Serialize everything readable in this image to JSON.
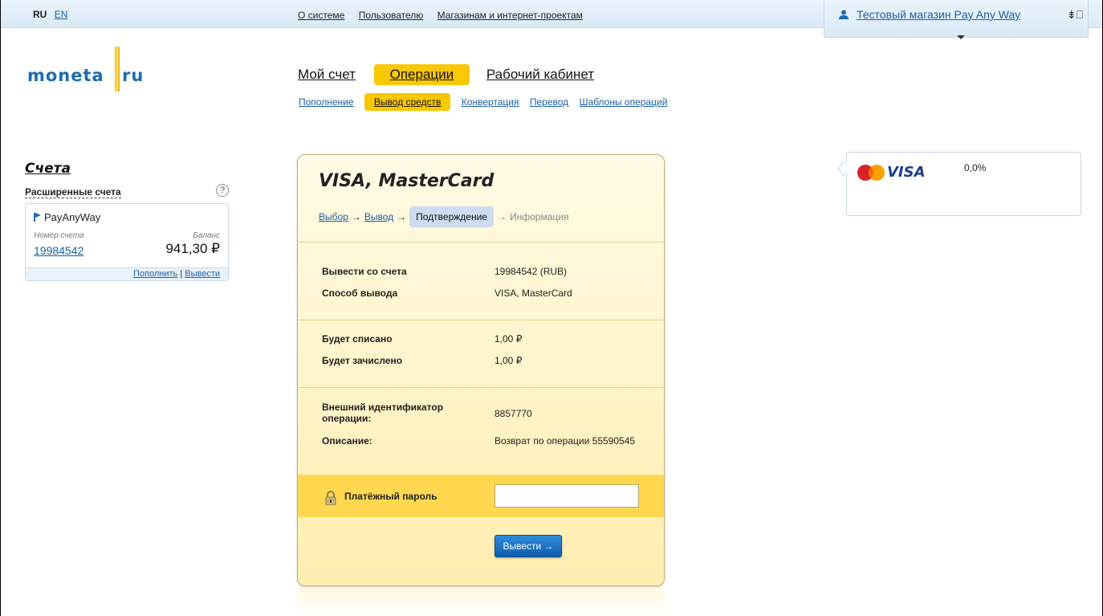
{
  "lang": {
    "ru": "RU",
    "en": "EN"
  },
  "topnav": [
    "О системе",
    "Пользователю",
    "Магазинам и интернет-проектам"
  ],
  "user": {
    "name": "Тестовый магазин Pay Any Way"
  },
  "logo": {
    "left": "moneta",
    "right": "ru"
  },
  "mainnav": {
    "account": "Мой счет",
    "operations": "Операции",
    "cabinet": "Рабочий кабинет"
  },
  "subnav": {
    "topup": "Пополнение",
    "withdraw": "Вывод средств",
    "convert": "Конвертация",
    "transfer": "Перевод",
    "templates": "Шаблоны операций"
  },
  "accounts": {
    "title": "Счета",
    "extended": "Расширенные счета",
    "help": "?",
    "card": {
      "name": "PayAnyWay",
      "num_label": "Номер счета",
      "bal_label": "Баланс",
      "number": "19984542",
      "balance": "941,30 ₽",
      "topup": "Пополнить",
      "sep": "|",
      "withdraw": "Вывести"
    }
  },
  "form": {
    "title": "VISA, MasterCard",
    "steps": {
      "s1": "Выбор",
      "s2": "Вывод",
      "s3": "Подтверждение",
      "s4": "Информация",
      "arrow": "→"
    },
    "rows": {
      "from_k": "Вывести со счета",
      "from_v": "19984542 (RUB)",
      "method_k": "Способ вывода",
      "method_v": "VISA, MasterCard",
      "debit_k": "Будет списано",
      "debit_v": "1,00 ₽",
      "credit_k": "Будет зачислено",
      "credit_v": "1,00 ₽",
      "extid_k": "Внешний идентификатор операции:",
      "extid_v": "8857770",
      "desc_k": "Описание:",
      "desc_v": "Возврат по операции 55590545"
    },
    "password_label": "Платёжный пароль",
    "password_value": "",
    "submit": "Вывести →"
  },
  "fee": {
    "brand": "VISA",
    "value": "0,0%"
  },
  "colors": {
    "accent": "#f9c800",
    "link": "#1a5fa8",
    "button": "#0f5cad"
  }
}
